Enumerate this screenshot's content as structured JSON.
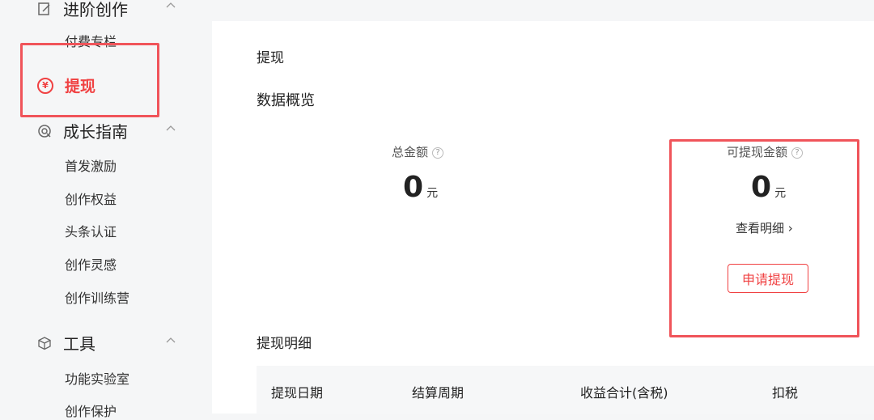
{
  "sidebar": {
    "advanced_group": "进阶创作",
    "paid_column": "付费专栏",
    "withdraw": "提现",
    "growth_group": "成长指南",
    "growth_items": [
      "首发激励",
      "创作权益",
      "头条认证",
      "创作灵感",
      "创作训练营"
    ],
    "tools_group": "工具",
    "tools_items": [
      "功能实验室",
      "创作保护"
    ],
    "yen_symbol": "¥"
  },
  "main": {
    "title": "提现",
    "overview": "数据概览",
    "total_label": "总金额",
    "total_value": "0",
    "unit": "元",
    "withdrawable_label": "可提现金额",
    "withdrawable_value": "0",
    "view_detail": "查看明细 ›",
    "apply_button": "申请提现",
    "detail_title": "提现明细",
    "table_headers": [
      "提现日期",
      "结算周期",
      "收益合计(含税)",
      "扣税"
    ],
    "help_glyph": "?"
  },
  "colors": {
    "accent": "#f04142",
    "highlight_box": "#f0545a",
    "bg": "#f5f6f7"
  }
}
